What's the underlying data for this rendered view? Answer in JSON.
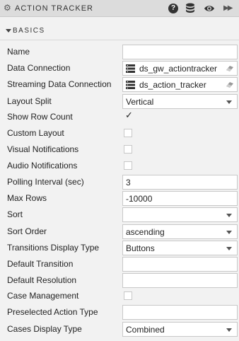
{
  "panel": {
    "title": "ACTION TRACKER",
    "help_icon": "?"
  },
  "section": {
    "label": "BASICS"
  },
  "fields": {
    "name": {
      "label": "Name",
      "value": ""
    },
    "data_connection": {
      "label": "Data Connection",
      "value": "ds_gw_actiontracker"
    },
    "streaming_data_connection": {
      "label": "Streaming Data Connection",
      "value": "ds_action_tracker"
    },
    "layout_split": {
      "label": "Layout Split",
      "value": "Vertical"
    },
    "show_row_count": {
      "label": "Show Row Count",
      "checked": true,
      "mark": "✓"
    },
    "custom_layout": {
      "label": "Custom Layout",
      "checked": false
    },
    "visual_notifications": {
      "label": "Visual Notifications",
      "checked": false
    },
    "audio_notifications": {
      "label": "Audio Notifications",
      "checked": false
    },
    "polling_interval": {
      "label": "Polling Interval (sec)",
      "value": "3"
    },
    "max_rows": {
      "label": "Max Rows",
      "value": "-10000"
    },
    "sort": {
      "label": "Sort",
      "value": ""
    },
    "sort_order": {
      "label": "Sort Order",
      "value": "ascending"
    },
    "transitions_display_type": {
      "label": "Transitions Display Type",
      "value": "Buttons"
    },
    "default_transition": {
      "label": "Default Transition",
      "value": ""
    },
    "default_resolution": {
      "label": "Default Resolution",
      "value": ""
    },
    "case_management": {
      "label": "Case Management",
      "checked": false
    },
    "preselected_action_type": {
      "label": "Preselected Action Type",
      "value": ""
    },
    "cases_display_type": {
      "label": "Cases Display Type",
      "value": "Combined"
    }
  }
}
